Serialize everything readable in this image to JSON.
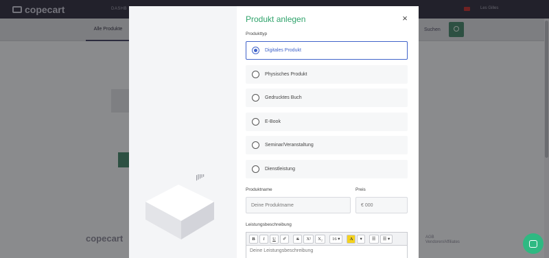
{
  "app": {
    "logo": "copecart",
    "nav_item": "DASHB",
    "user": "Les Gilles",
    "tab_active": "Alle Produkte",
    "search_label": "Suchen",
    "footer_logo": "copecart",
    "footer_links": [
      "AGB",
      "Vendoren/Affiliates"
    ]
  },
  "modal": {
    "title": "Produkt anlegen",
    "close_glyph": "×",
    "product_type_label": "Produkttyp",
    "product_types": [
      {
        "label": "Digitales Produkt",
        "selected": true
      },
      {
        "label": "Physisches Produkt",
        "selected": false
      },
      {
        "label": "Gedrucktes Buch",
        "selected": false
      },
      {
        "label": "E-Book",
        "selected": false
      },
      {
        "label": "Seminar/Veranstaltung",
        "selected": false
      },
      {
        "label": "Dienstleistung",
        "selected": false
      }
    ],
    "name_label": "Produktname",
    "name_placeholder": "Deine Produktname",
    "price_label": "Preis",
    "price_placeholder": "€ 000",
    "description_label": "Leistungsbeschreibung",
    "description_placeholder": "Deine Leistungsbeschreibung",
    "toolbar": {
      "bold": "B",
      "italic": "I",
      "underline": "U",
      "eraser": "✐",
      "strike": "S",
      "superscript": "X²",
      "subscript": "X₂",
      "font_size": "16 ▾",
      "color": "A",
      "color_caret": "▾",
      "list": "☰",
      "align": "☰ ▾"
    }
  },
  "colors": {
    "title_green": "#2fa36b",
    "selected_blue": "#3f62c9",
    "chat_green": "#2fb982"
  }
}
